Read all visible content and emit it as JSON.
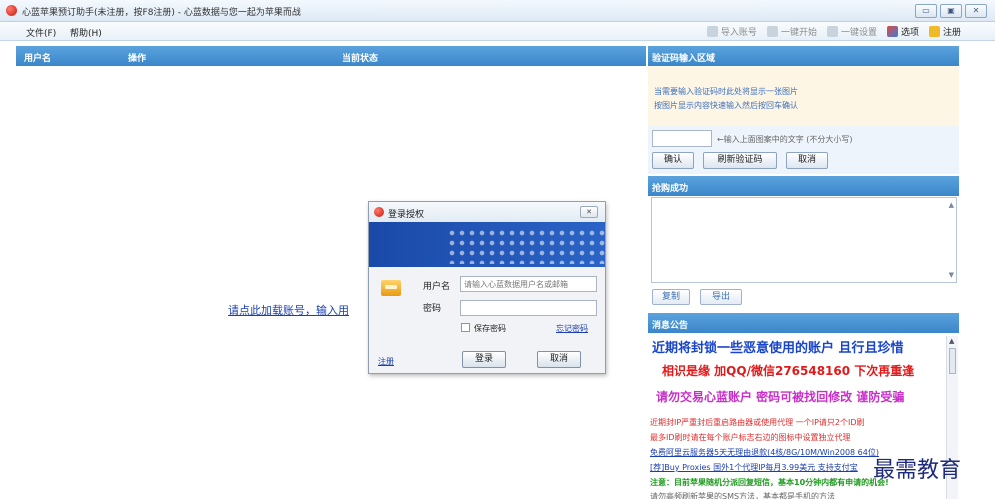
{
  "window": {
    "title": "心蓝苹果预订助手(未注册，按F8注册) - 心蓝数据与您一起为苹果而战",
    "controls": [
      "▭",
      "▣",
      "✕"
    ]
  },
  "menu": {
    "file": "文件(F)",
    "help": "帮助(H)"
  },
  "toolbar": {
    "import_accounts": "导入账号",
    "one_click_start": "一键开始",
    "one_click_settings": "一键设置",
    "options": "选项",
    "register": "注册"
  },
  "list": {
    "columns": [
      "用户名",
      "操作",
      "当前状态"
    ],
    "load_link": "请点此加载账号，输入用"
  },
  "captcha": {
    "header": "验证码输入区域",
    "hint_line1": "当需要输入验证码时此处将显示一张图片",
    "hint_line2": "按图片显示内容快速输入然后按回车确认",
    "input_hint": "←输入上面图案中的文字 (不分大小写)",
    "confirm_btn": "确认",
    "refresh_btn": "刷新验证码",
    "cancel_btn": "取消"
  },
  "result": {
    "header": "抢购成功",
    "copy_btn": "复制",
    "export_btn": "导出"
  },
  "notice": {
    "header": "消息公告",
    "line1": "近期将封锁一些恶意使用的账户 且行且珍惜",
    "line2": "相识是缘 加QQ/微信276548160 下次再重逢",
    "line3": "请勿交易心蓝账户 密码可被找回修改 谨防受骗",
    "line4": "近期封IP严重封后重启路由器或使用代理 一个IP请只2个ID刷",
    "line5": "最多ID刷时请在每个账户标志右边的图标中设置独立代理",
    "line6": "免费阿里云服务器5天无理由退款(4核/8G/10M/Win2008 64位)",
    "line7": "[荐]Buy Proxies 国外1个代理IP每月3.99美元 支持支付宝",
    "line8": "注意：目前苹果随机分派回复短信，基本10分钟内都有申请的机会!",
    "line9": "请勿高频刷新苹果的SMS方法，基本都是手机的方法"
  },
  "login_dialog": {
    "title": "登录授权",
    "username_label": "用户名",
    "username_placeholder": "请输入心蓝数据用户名或邮箱",
    "password_label": "密码",
    "remember_label": "保存密码",
    "forgot_link": "忘记密码",
    "register_link": "注册",
    "login_btn": "登录",
    "cancel_btn": "取消"
  },
  "watermark": "最需教育"
}
